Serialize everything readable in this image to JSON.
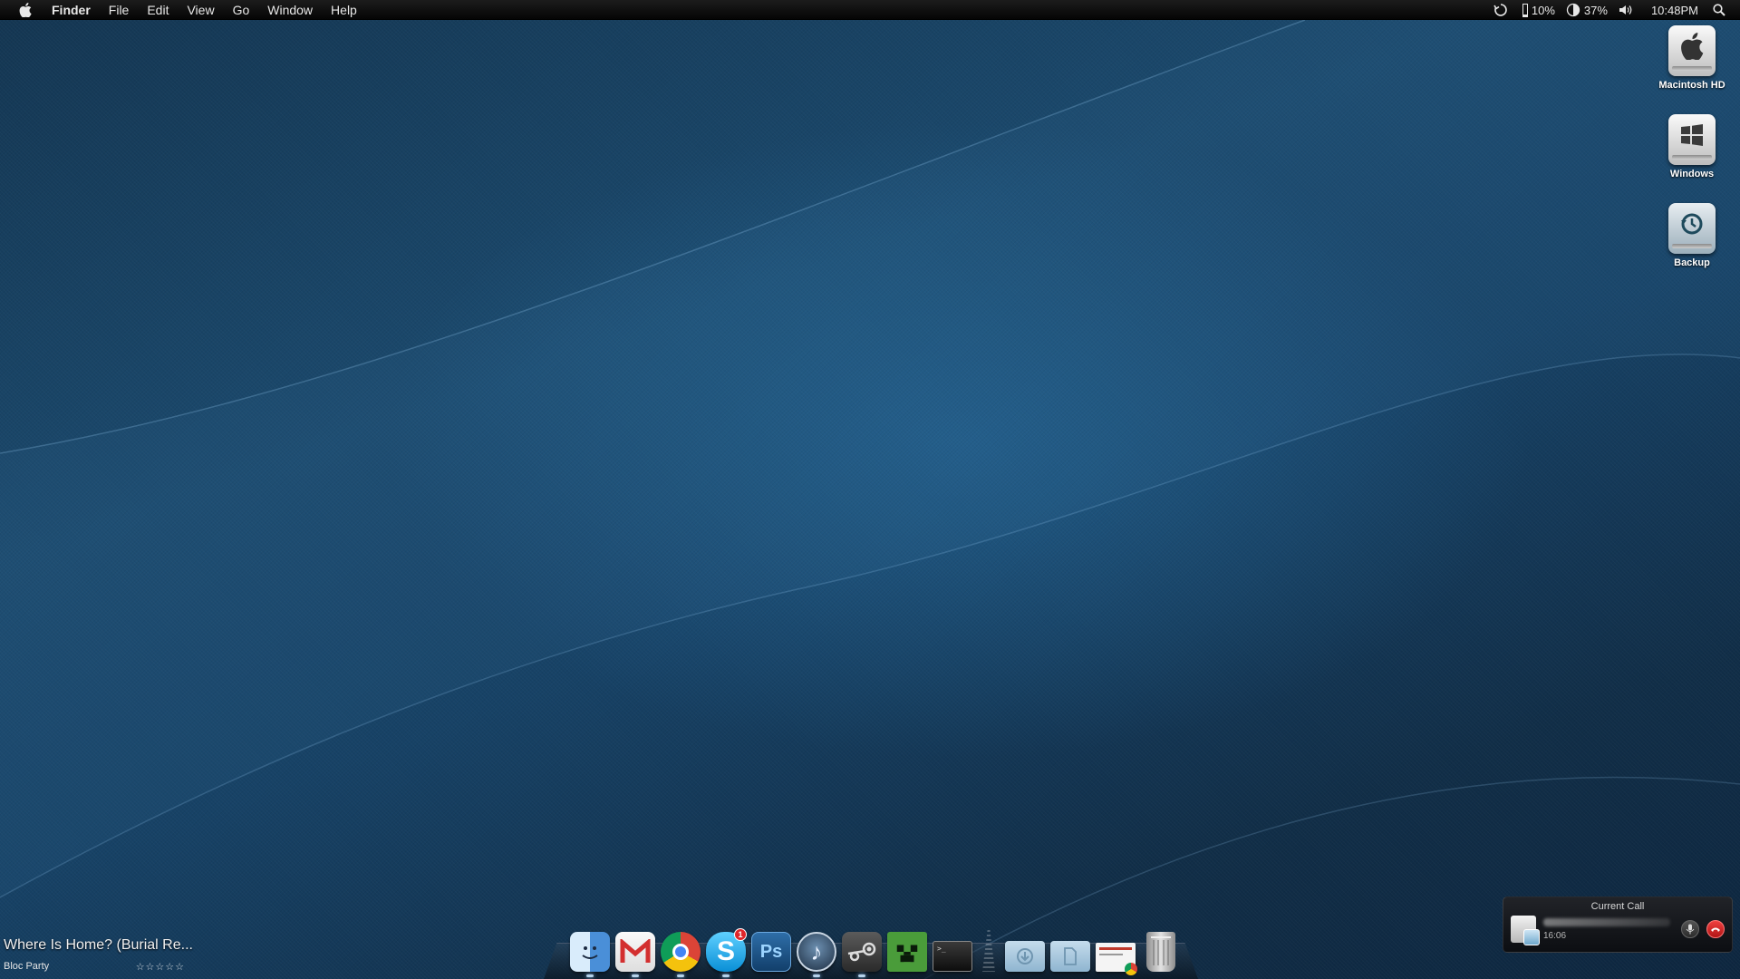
{
  "menubar": {
    "apple_icon": "apple-icon",
    "app_name": "Finder",
    "menus": [
      "File",
      "Edit",
      "View",
      "Go",
      "Window",
      "Help"
    ],
    "status": {
      "sync_icon": "time-machine-sync-icon",
      "cpu": "10%",
      "cpu_icon": "cpu-meter-icon",
      "battery": "37%",
      "battery_icon": "half-moon-meter-icon",
      "volume_icon": "speaker-icon",
      "clock": "10:48PM",
      "spotlight_icon": "magnifier-icon"
    }
  },
  "desktop": {
    "icons": [
      {
        "label": "Macintosh HD",
        "icon": "apple-drive-icon"
      },
      {
        "label": "Windows",
        "icon": "windows-drive-icon"
      },
      {
        "label": "Backup",
        "icon": "time-machine-drive-icon"
      }
    ]
  },
  "dock": {
    "apps": [
      {
        "name": "Finder",
        "icon": "finder-icon",
        "running": true
      },
      {
        "name": "Gmail",
        "icon": "gmail-icon",
        "running": true
      },
      {
        "name": "Chrome",
        "icon": "chrome-icon",
        "running": true
      },
      {
        "name": "Skype",
        "icon": "skype-icon",
        "running": true,
        "badge": "1"
      },
      {
        "name": "Photoshop",
        "icon": "photoshop-icon",
        "label": "Ps",
        "running": false
      },
      {
        "name": "iTunes",
        "icon": "itunes-icon",
        "running": true
      },
      {
        "name": "Steam",
        "icon": "steam-icon",
        "running": true
      },
      {
        "name": "Minecraft",
        "icon": "minecraft-icon",
        "running": false
      },
      {
        "name": "Terminal",
        "icon": "terminal-icon",
        "running": false
      }
    ],
    "stacks": [
      {
        "name": "Downloads",
        "icon": "downloads-folder-icon"
      },
      {
        "name": "Documents",
        "icon": "documents-folder-icon"
      },
      {
        "name": "Web document",
        "icon": "chrome-document-icon"
      },
      {
        "name": "Trash",
        "icon": "trash-icon"
      }
    ],
    "colors": {
      "indicator": "#9cd0ff"
    }
  },
  "now_playing": {
    "title": "Where Is Home? (Burial Re...",
    "artist": "Bloc Party",
    "rating": "☆☆☆☆☆"
  },
  "call": {
    "title": "Current Call",
    "duration": "16:06",
    "mute_icon": "microphone-icon",
    "hangup_icon": "hang-up-icon"
  }
}
